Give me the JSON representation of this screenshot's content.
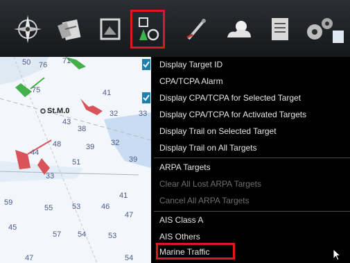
{
  "toolbar": {
    "tools": [
      {
        "name": "compass-icon"
      },
      {
        "name": "route-tools-icon"
      },
      {
        "name": "chart-layer-icon"
      },
      {
        "name": "target-tracking-icon",
        "selected": true
      },
      {
        "name": "measure-icon"
      },
      {
        "name": "weather-icon"
      },
      {
        "name": "report-icon"
      },
      {
        "name": "settings-gears-icon"
      }
    ],
    "selected_outline_color": "#e01818"
  },
  "chart": {
    "position_label": "St.M.0",
    "soundings": [
      "50",
      "76",
      "71",
      "75",
      "41",
      "43",
      "38",
      "32",
      "33",
      "48",
      "39",
      "32",
      "44",
      "51",
      "39",
      "33",
      "41",
      "59",
      "55",
      "53",
      "46",
      "47",
      "45",
      "57",
      "54",
      "53",
      "47",
      "54"
    ]
  },
  "menu": {
    "groups": [
      [
        {
          "label": "Display Target ID",
          "checked": true
        },
        {
          "label": "CPA/TCPA Alarm",
          "checked": false
        },
        {
          "label": "Display CPA/TCPA for Selected Target",
          "checked": true
        },
        {
          "label": "Display CPA/TCPA for Activated Targets",
          "checked": false
        },
        {
          "label": "Display Trail on Selected Target",
          "checked": false
        },
        {
          "label": "Display Trail on All Targets",
          "checked": false
        }
      ],
      [
        {
          "label": "ARPA Targets",
          "checked": false
        },
        {
          "label": "Clear All Lost ARPA Targets",
          "disabled": true
        },
        {
          "label": "Cancel All ARPA Targets",
          "disabled": true
        }
      ],
      [
        {
          "label": "AIS Class A",
          "checked": false
        },
        {
          "label": "AIS Others",
          "checked": false
        },
        {
          "label": "Marine Traffic",
          "highlighted": true
        }
      ]
    ],
    "check_color": "#1e7fae",
    "highlight_color": "#e01818"
  }
}
